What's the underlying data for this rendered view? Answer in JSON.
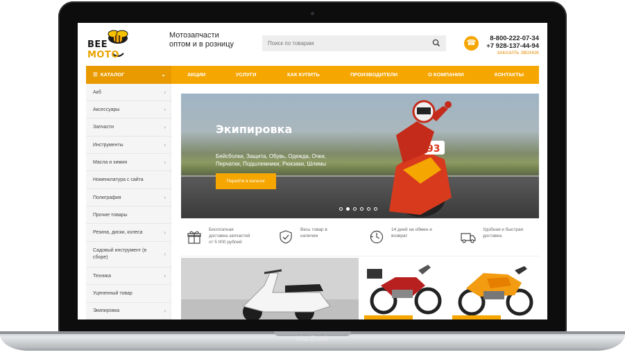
{
  "device": {
    "label": "MacBook"
  },
  "header": {
    "logo_text_1": "BEE",
    "logo_text_2": "MOTO",
    "tagline_line1": "Мотозапчасти",
    "tagline_line2": "оптом и в розницу",
    "search_placeholder": "Поиск по товарам",
    "phone_1": "8-800-222-07-34",
    "phone_2": "+7 928-137-44-94",
    "callback_label": "ЗАКАЗАТЬ ЗВОНОК"
  },
  "nav": {
    "catalog_label": "КАТАЛОГ",
    "items": [
      "АКЦИИ",
      "УСЛУГИ",
      "КАК КУПИТЬ",
      "ПРОИЗВОДИТЕЛИ",
      "О КОМПАНИИ",
      "КОНТАКТЫ"
    ]
  },
  "sidebar": {
    "items": [
      "Акб",
      "Аксессуары",
      "Запчасти",
      "Инструменты",
      "Масла и химия",
      "Номенклатура с сайта",
      "Полиграфия",
      "Прочие товары",
      "Резина, диски, колеса",
      "Садовый инструмент (в сборе)",
      "Техника",
      "Уцененный товар",
      "Экипировка"
    ]
  },
  "hero": {
    "title": "Экипировка",
    "desc_line1": "Бейсболки, Защита, Обувь, Одежда, Очки,",
    "desc_line2": "Перчатки, Подшлемники, Рюкзаки, Шлемы",
    "button_label": "Перейти в каталог",
    "rider_number": "93",
    "slides_total": 6,
    "active_slide": 1
  },
  "features": [
    {
      "icon": "gift-icon",
      "text_1": "Бесплатная",
      "text_2": "доставка запчастей",
      "text_3": "от 5 000 рублей"
    },
    {
      "icon": "shield-check-icon",
      "text_1": "Весь товар в",
      "text_2": "наличии",
      "text_3": ""
    },
    {
      "icon": "clock-icon",
      "text_1": "14 дней на обмен и",
      "text_2": "возврат",
      "text_3": ""
    },
    {
      "icon": "truck-icon",
      "text_1": "Удобная и быстрая",
      "text_2": "доставка",
      "text_3": ""
    }
  ],
  "colors": {
    "accent": "#f6a600",
    "accent_dark": "#e99a00",
    "text": "#222222"
  }
}
